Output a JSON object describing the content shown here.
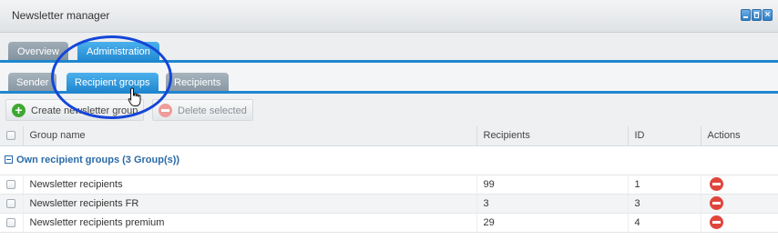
{
  "window": {
    "title": "Newsletter manager",
    "controls": [
      "minimize-icon",
      "maximize-icon",
      "close-icon"
    ]
  },
  "main_tabs": [
    {
      "label": "Overview",
      "active": false
    },
    {
      "label": "Administration",
      "active": true
    }
  ],
  "sub_tabs": [
    {
      "label": "Sender",
      "active": false
    },
    {
      "label": "Recipient groups",
      "active": true
    },
    {
      "label": "Recipients",
      "active": false
    }
  ],
  "toolbar": {
    "create_label": "Create newsletter group",
    "delete_label": "Delete selected"
  },
  "grid": {
    "columns": [
      "Group name",
      "Recipients",
      "ID",
      "Actions"
    ],
    "group_header": "Own recipient groups (3 Group(s))",
    "rows": [
      {
        "name": "Newsletter recipients",
        "recipients": "99",
        "id": "1"
      },
      {
        "name": "Newsletter recipients FR",
        "recipients": "3",
        "id": "3"
      },
      {
        "name": "Newsletter recipients premium",
        "recipients": "29",
        "id": "4"
      }
    ]
  },
  "colors": {
    "accent": "#1f86cf",
    "annotation_circle": "#1446d8",
    "delete": "#e0453c",
    "add": "#3ea832"
  }
}
